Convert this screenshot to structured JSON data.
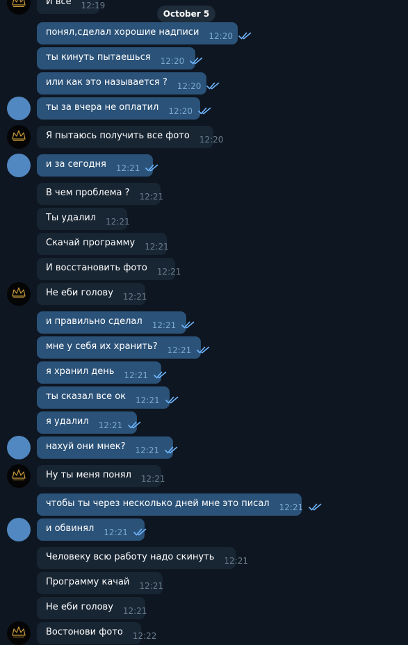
{
  "date_separator": "October 5",
  "colors": {
    "background": "#0e1621",
    "incoming_bubble": "#182533",
    "outgoing_bubble": "#2b5278",
    "read_check": "#6fb7ff",
    "avatar_blue": "#5288c1",
    "logo_gold": "#c99a3b"
  },
  "messages": [
    {
      "text": "И все",
      "time": "12:19",
      "direction": "in",
      "read": false
    },
    {
      "text": "понял,сделал хорошие надписи",
      "time": "12:20",
      "direction": "out",
      "read": true
    },
    {
      "text": "ты кинуть пытаешься",
      "time": "12:20",
      "direction": "out",
      "read": true
    },
    {
      "text": "или как это называется ?",
      "time": "12:20",
      "direction": "out",
      "read": true
    },
    {
      "text": "ты за вчера не оплатил",
      "time": "12:20",
      "direction": "out",
      "read": true
    },
    {
      "text": "Я пытаюсь получить все фото",
      "time": "12:20",
      "direction": "in",
      "read": false
    },
    {
      "text": "и за сегодня",
      "time": "12:21",
      "direction": "out",
      "read": true
    },
    {
      "text": "В чем проблема ?",
      "time": "12:21",
      "direction": "in",
      "read": false
    },
    {
      "text": "Ты удалил",
      "time": "12:21",
      "direction": "in",
      "read": false
    },
    {
      "text": "Скачай программу",
      "time": "12:21",
      "direction": "in",
      "read": false
    },
    {
      "text": "И восстановить фото",
      "time": "12:21",
      "direction": "in",
      "read": false
    },
    {
      "text": "Не еби голову",
      "time": "12:21",
      "direction": "in",
      "read": false
    },
    {
      "text": "и правильно сделал",
      "time": "12:21",
      "direction": "out",
      "read": true
    },
    {
      "text": "мне у себя их хранить?",
      "time": "12:21",
      "direction": "out",
      "read": true
    },
    {
      "text": "я хранил день",
      "time": "12:21",
      "direction": "out",
      "read": true
    },
    {
      "text": "ты сказал все ок",
      "time": "12:21",
      "direction": "out",
      "read": true
    },
    {
      "text": "я удалил",
      "time": "12:21",
      "direction": "out",
      "read": true
    },
    {
      "text": "нахуй они мнек?",
      "time": "12:21",
      "direction": "out",
      "read": true
    },
    {
      "text": "Ну ты меня понял",
      "time": "12:21",
      "direction": "in",
      "read": false
    },
    {
      "text": "чтобы ты через несколько дней мне это писал",
      "time": "12:21",
      "direction": "out",
      "read": true
    },
    {
      "text": "и обвинял",
      "time": "12:21",
      "direction": "out",
      "read": true
    },
    {
      "text": "Человеку всю работу надо скинуть",
      "time": "12:21",
      "direction": "in",
      "read": false
    },
    {
      "text": "Программу качай",
      "time": "12:21",
      "direction": "in",
      "read": false
    },
    {
      "text": "Не еби голову",
      "time": "12:21",
      "direction": "in",
      "read": false
    },
    {
      "text": "Востонови фото",
      "time": "12:22",
      "direction": "in",
      "read": false
    }
  ]
}
